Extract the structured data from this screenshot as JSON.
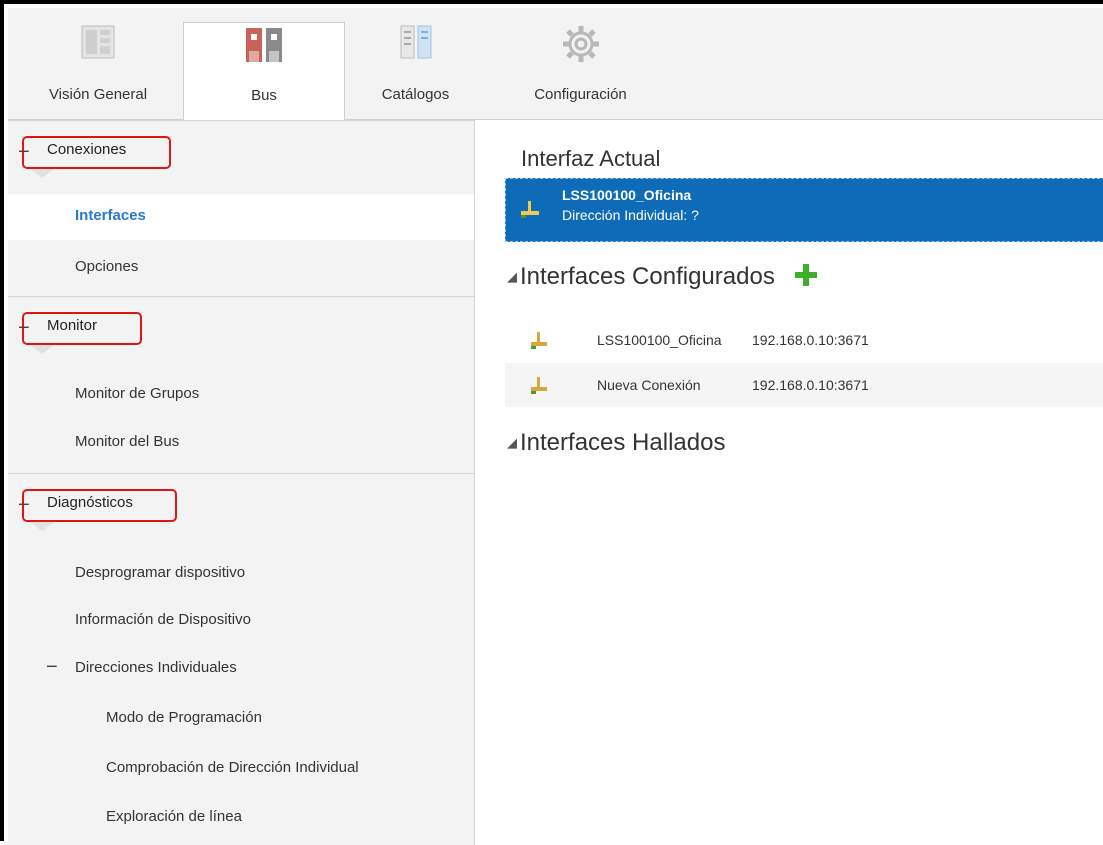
{
  "ribbon": {
    "tabs": [
      {
        "label": "Visión General",
        "icon": "overview-icon"
      },
      {
        "label": "Bus",
        "icon": "bus-icon",
        "active": true
      },
      {
        "label": "Catálogos",
        "icon": "catalogs-icon"
      },
      {
        "label": "Configuración",
        "icon": "gear-icon"
      }
    ]
  },
  "sidebar": {
    "groups": [
      {
        "title": "Conexiones",
        "items": [
          "Interfaces",
          "Opciones"
        ]
      },
      {
        "title": "Monitor",
        "items": [
          "Monitor de Grupos",
          "Monitor del Bus"
        ]
      },
      {
        "title": "Diagnósticos",
        "items": [
          "Desprogramar dispositivo",
          "Información de Dispositivo",
          "Direcciones Individuales",
          "Modo de Programación",
          "Comprobación de Dirección Individual",
          "Exploración de línea"
        ]
      }
    ],
    "selected_item": "Interfaces"
  },
  "main": {
    "current_title": "Interfaz Actual",
    "current": {
      "name": "LSS100100_Oficina",
      "address": "Dirección Individual: ?"
    },
    "configured_title": "Interfaces Configurados",
    "configured": [
      {
        "name": "LSS100100_Oficina",
        "ip": "192.168.0.10:3671"
      },
      {
        "name": "Nueva Conexión",
        "ip": "192.168.0.10:3671"
      }
    ],
    "found_title": "Interfaces Hallados"
  },
  "colors": {
    "selection": "#0e6bb8",
    "highlight": "#e01616",
    "link": "#2a7ac8",
    "add": "#3fae2a"
  }
}
